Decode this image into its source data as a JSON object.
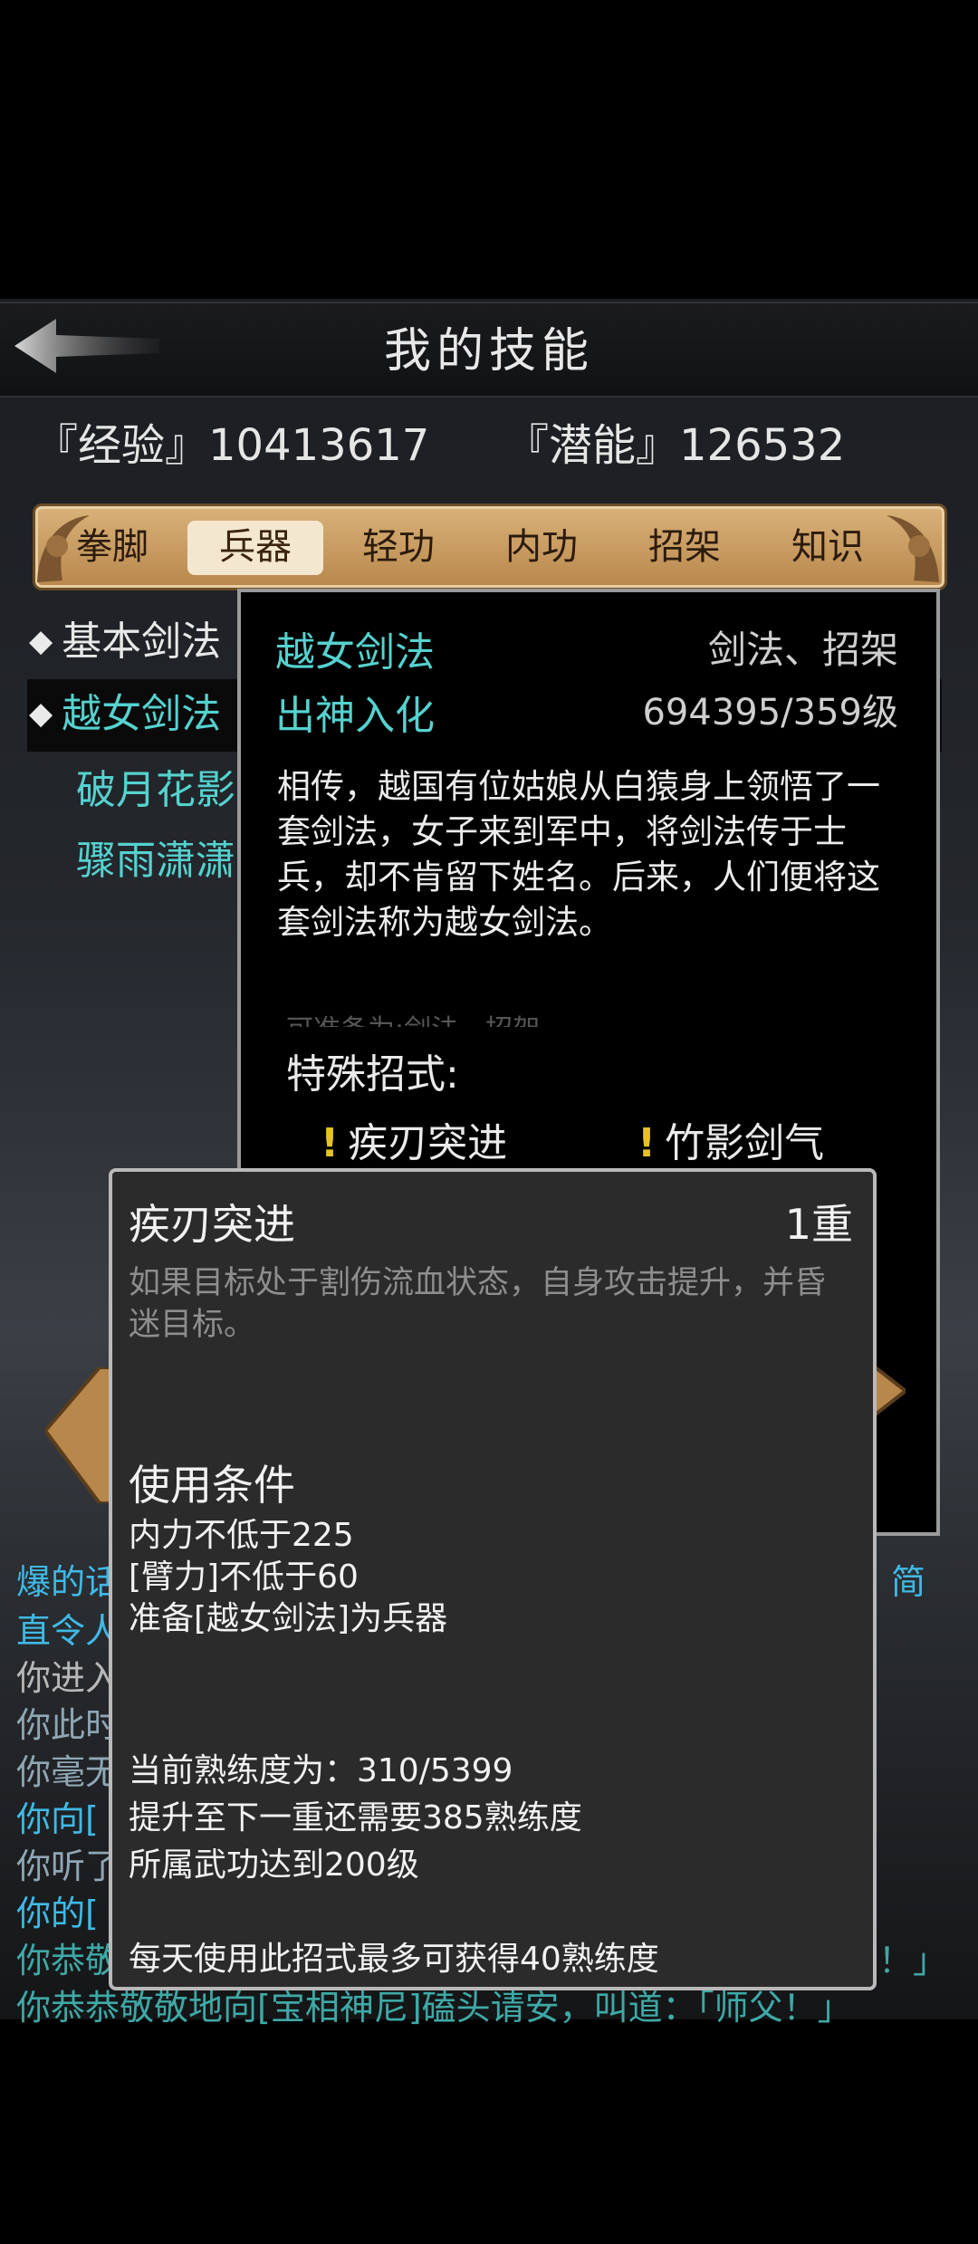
{
  "header": {
    "title": "我的技能"
  },
  "stats": {
    "exp_label": "『经验』10413617",
    "potential_label": "『潜能』126532"
  },
  "tabs": [
    "拳脚",
    "兵器",
    "轻功",
    "内功",
    "招架",
    "知识"
  ],
  "active_tab": "兵器",
  "skill_list": [
    {
      "label": "基本剑法",
      "visible": "基本剑法"
    },
    {
      "label": "越女剑法",
      "visible": "越女剑法"
    },
    {
      "label": "破月花影",
      "visible": "破月花影"
    },
    {
      "label": "骤雨潇潇",
      "visible": "骤雨潇潇"
    }
  ],
  "skill_info": {
    "name": "越女剑法",
    "types": "剑法、招架",
    "level_name": "出神入化",
    "progress": "694395/359级",
    "description": "相传，越国有位姑娘从白猿身上领悟了一套剑法，女子来到军中，将剑法传于士兵，却不肯留下姓名。后来，人们便将这套剑法称为越女剑法。",
    "faded_line": "可准备为:剑法、招架",
    "special_moves_label": "特殊招式:",
    "moves": [
      "疾刃突进",
      "竹影剑气"
    ]
  },
  "chat": {
    "lines": [
      {
        "text": "爆的话",
        "color": "#3fb9e6"
      },
      {
        "text": "直令人",
        "color": "#3fb9e6"
      },
      {
        "text": "你进入",
        "color": "#b8b8b8"
      },
      {
        "text": "你此时",
        "color": "#8fa7b5"
      },
      {
        "text": "你毫无",
        "color": "#8fa7b5"
      },
      {
        "text": "你向[",
        "color": "#3fb9e6"
      },
      {
        "text": "你听了",
        "color": "#8fa7b5"
      },
      {
        "text": "你的[",
        "color": "#3fb9e6"
      },
      {
        "text": "你恭敬",
        "color": "#3ea9a6"
      }
    ],
    "right_fragment_1": "简",
    "right_fragment_2": "！」",
    "last_line": "你恭恭敬敬地向[宝相神尼]磕头请安，叫道：「师父！」"
  },
  "popup": {
    "move_name": "疾刃突进",
    "tier": "1重",
    "effect": "如果目标处于割伤流血状态，自身攻击提升，并昏迷目标。",
    "conditions_title": "使用条件",
    "conditions": [
      "内力不低于225",
      "[臂力]不低于60",
      "准备[越女剑法]为兵器"
    ],
    "proficiency": "当前熟练度为：310/5399",
    "next_tier_need": "提升至下一重还需要385熟练度",
    "skill_level_req": "所属武功达到200级",
    "daily_limit": "每天使用此招式最多可获得40熟练度"
  },
  "colors": {
    "cyan_text": "#55d2cf",
    "tab_gold": "#c9975a",
    "popup_bg": "#2b2b2b",
    "panel_border": "#9a9a9a",
    "bang_yellow": "#e6c224"
  }
}
